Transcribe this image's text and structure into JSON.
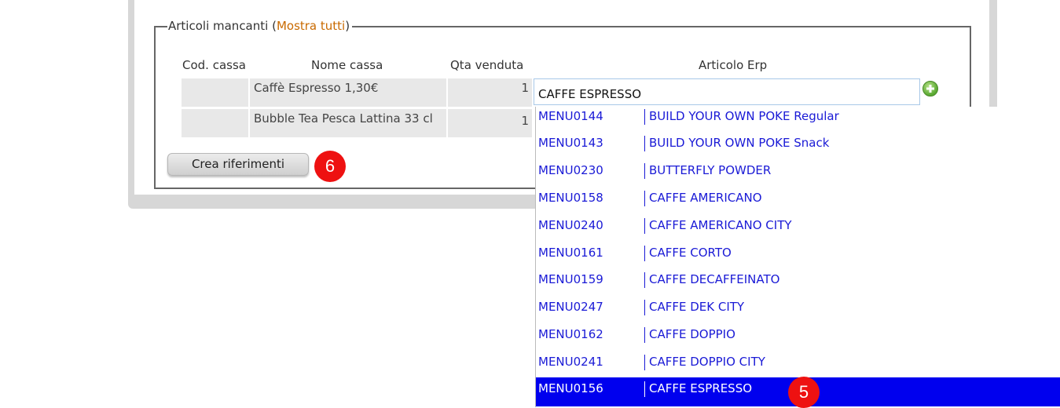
{
  "section": {
    "title": "Articoli mancanti",
    "paren_open": "(",
    "show_all_link": "Mostra tutti",
    "paren_close": ")"
  },
  "table": {
    "headers": [
      "Cod. cassa",
      "Nome cassa",
      "Qta venduta",
      "Articolo Erp"
    ],
    "rows": [
      {
        "cod_cassa": "",
        "nome_cassa": "Caffè Espresso 1,30€",
        "qta_venduta": "1"
      },
      {
        "cod_cassa": "",
        "nome_cassa": "Bubble Tea Pesca Lattina 33 cl",
        "qta_venduta": "1"
      }
    ]
  },
  "erp_input": {
    "value": "CAFFE ESPRESSO"
  },
  "create_button": {
    "label": "Crea riferimenti"
  },
  "badges": {
    "button_step": "6",
    "selection_step": "5"
  },
  "dropdown": {
    "items": [
      {
        "code": "MENU0144",
        "name": "BUILD YOUR OWN POKE Regular"
      },
      {
        "code": "MENU0143",
        "name": "BUILD YOUR OWN POKE Snack"
      },
      {
        "code": "MENU0230",
        "name": "BUTTERFLY POWDER"
      },
      {
        "code": "MENU0158",
        "name": "CAFFE AMERICANO"
      },
      {
        "code": "MENU0240",
        "name": "CAFFE AMERICANO CITY"
      },
      {
        "code": "MENU0161",
        "name": "CAFFE CORTO"
      },
      {
        "code": "MENU0159",
        "name": "CAFFE DECAFFEINATO"
      },
      {
        "code": "MENU0247",
        "name": "CAFFE DEK CITY"
      },
      {
        "code": "MENU0162",
        "name": "CAFFE DOPPIO"
      },
      {
        "code": "MENU0241",
        "name": "CAFFE DOPPIO CITY"
      },
      {
        "code": "MENU0156",
        "name": "CAFFE ESPRESSO"
      }
    ],
    "selected_index": 10
  },
  "colors": {
    "link": "#c96a00",
    "dropdown_text": "#1a1ad6",
    "selection_bg": "#0000ee",
    "badge": "#ee1111"
  }
}
